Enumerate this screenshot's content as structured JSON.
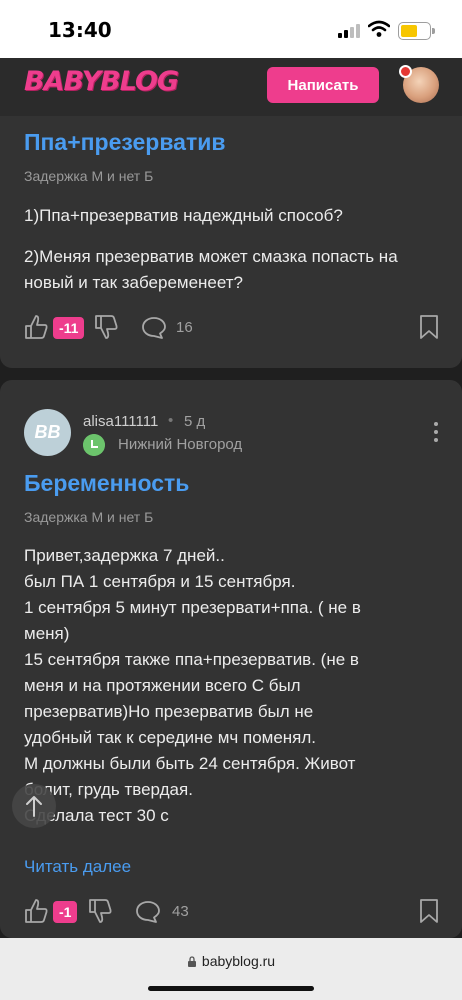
{
  "status_bar": {
    "time": "13:40"
  },
  "header": {
    "logo": "BABYBLOG",
    "write_button": "Написать",
    "brand_color": "#ee3d8d"
  },
  "posts": [
    {
      "title": "Ппа+презерватив",
      "tag": "Задержка М и нет Б",
      "paragraphs": [
        "1)Ппа+презерватив надеждный способ?",
        "2)Меняя презерватив может смазка попасть на новый и так забеременеет?"
      ],
      "score": "-11",
      "comments": "16"
    },
    {
      "author": "alisa111111",
      "avatar_initials": "BB",
      "time": "5 д",
      "city": "Нижний Новгород",
      "title": "Беременность",
      "tag": "Задержка М и нет Б",
      "body_lines": [
        "Привет,задержка 7 дней..",
        "был ПА 1 сентября и 15 сентября.",
        "1 сентября 5 минут презервати+ппа. ( не в",
        "меня)",
        "15 сентября также ппа+презерватив. (не в",
        "меня и на протяжении всего С был",
        "презерватив)Но презерватив был не",
        "удобный так к середине мч поменял.",
        "М должны были быть 24 сентября. Живот",
        "болит, грудь твердая.",
        "Сделала тест 30 с"
      ],
      "read_more": "Читать далее",
      "score": "-1",
      "comments": "43"
    }
  ],
  "browser": {
    "url": "babyblog.ru"
  },
  "icons": {
    "like": "thumb-up-icon",
    "dislike": "thumb-down-icon",
    "comments": "comment-bubble-icon",
    "bookmark": "bookmark-icon",
    "more": "more-vertical-icon",
    "scroll_top": "arrow-up-icon",
    "lock": "lock-icon"
  },
  "colors": {
    "accent": "#ee3d8d",
    "link": "#4a9cf0",
    "card": "#333333",
    "background": "#1f1f1f"
  }
}
